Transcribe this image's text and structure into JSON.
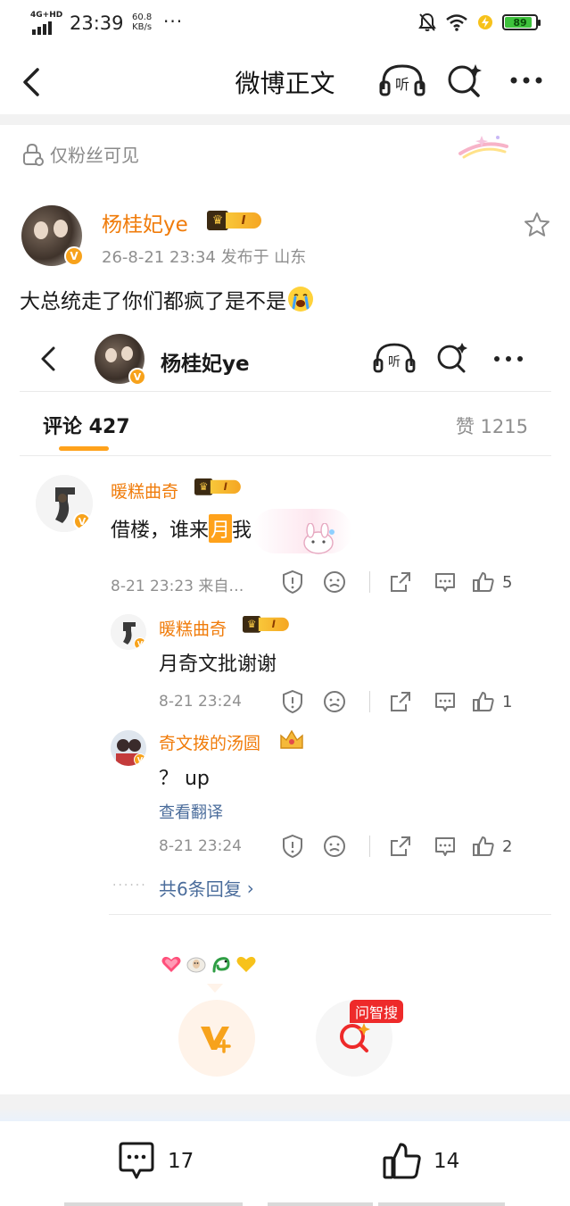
{
  "status_bar": {
    "network": "4G+HD",
    "time": "23:39",
    "speed_value": "60.8",
    "speed_unit": "KB/s",
    "more": "···",
    "battery_level": "89",
    "battery_fraction": 0.89
  },
  "nav": {
    "title": "微博正文"
  },
  "post": {
    "visibility": "仅粉丝可见",
    "author": {
      "name": "杨桂妃ye",
      "level": "I",
      "verified": "V"
    },
    "meta": "26-8-21 23:34  发布于 山东",
    "text": "大总统走了你们都疯了是不是"
  },
  "embed": {
    "header_title": "杨桂妃ye",
    "tab_label": "评论 427",
    "likes_label": "赞 1215",
    "comments": [
      {
        "name": "暖糕曲奇",
        "level": "I",
        "text_before": "借楼，谁来",
        "text_highlight": "月",
        "text_after": "我",
        "time": "8-21 23:23  来自…",
        "like_count": "5"
      },
      {
        "name": "暖糕曲奇",
        "level": "I",
        "text": "月奇文批谢谢",
        "time": "8-21 23:24",
        "like_count": "1"
      },
      {
        "name": "奇文拨的汤圆",
        "text": "？ up",
        "translate": "查看翻译",
        "time": "8-21 23:24",
        "like_count": "2"
      }
    ],
    "replies_dots": "······",
    "replies_label": "共6条回复",
    "replies_arrow": "›"
  },
  "floating": {
    "ask_badge": "问智搜"
  },
  "bottom_bar": {
    "comment_count": "17",
    "like_count": "14"
  },
  "colors": {
    "brand_orange": "#f07c0b",
    "link_blue": "#4a6c9b",
    "badge_red": "#ee2a2a"
  }
}
